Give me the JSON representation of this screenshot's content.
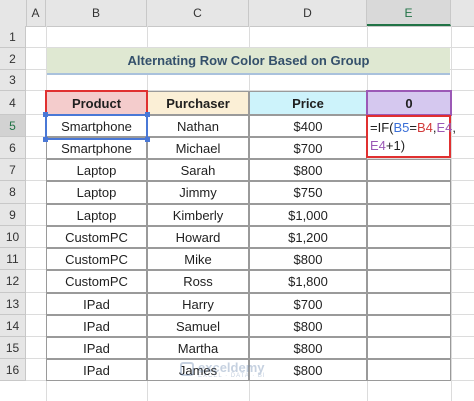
{
  "columns": [
    "A",
    "B",
    "C",
    "D",
    "E"
  ],
  "rows": [
    "1",
    "2",
    "3",
    "4",
    "5",
    "6",
    "7",
    "8",
    "9",
    "10",
    "11",
    "12",
    "13",
    "14",
    "15",
    "16"
  ],
  "title": "Alternating Row Color Based on Group",
  "headers": {
    "product": "Product",
    "purchaser": "Purchaser",
    "price": "Price",
    "e": "0"
  },
  "table": [
    {
      "product": "Smartphone",
      "purchaser": "Nathan",
      "price": "$400"
    },
    {
      "product": "Smartphone",
      "purchaser": "Michael",
      "price": "$700"
    },
    {
      "product": "Laptop",
      "purchaser": "Sarah",
      "price": "$800"
    },
    {
      "product": "Laptop",
      "purchaser": "Jimmy",
      "price": "$750"
    },
    {
      "product": "Laptop",
      "purchaser": "Kimberly",
      "price": "$1,000"
    },
    {
      "product": "CustomPC",
      "purchaser": "Howard",
      "price": "$1,200"
    },
    {
      "product": "CustomPC",
      "purchaser": "Mike",
      "price": "$800"
    },
    {
      "product": "CustomPC",
      "purchaser": "Ross",
      "price": "$1,800"
    },
    {
      "product": "IPad",
      "purchaser": "Harry",
      "price": "$700"
    },
    {
      "product": "IPad",
      "purchaser": "Samuel",
      "price": "$800"
    },
    {
      "product": "IPad",
      "purchaser": "Martha",
      "price": "$800"
    },
    {
      "product": "IPad",
      "purchaser": "James",
      "price": "$800"
    }
  ],
  "formula": {
    "p1": "=IF(",
    "b5": "B5",
    "eq": "=",
    "b4": "B4",
    "c1": ",",
    "e4a": "E4",
    "c2": ",",
    "e4b": "E4",
    "tail": "+1)"
  },
  "watermark": {
    "name": "exceldemy",
    "tagline": "EXCEL · DATA · BI"
  },
  "colors": {
    "product_header": "#f4cccc",
    "purchaser_header": "#fbefd6",
    "price_header": "#cdf3fb",
    "e_header": "#d5c8ef",
    "title_bg": "#dfe8d2"
  }
}
